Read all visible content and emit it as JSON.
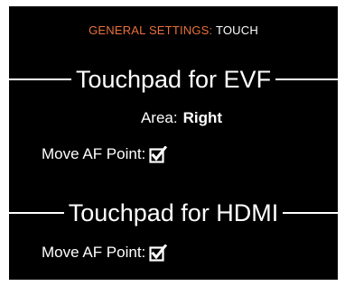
{
  "theme": {
    "background": "#000000",
    "text": "#ffffff",
    "accent": "#e8703a"
  },
  "header": {
    "crumb": "GENERAL SETTINGS:",
    "current": "TOUCH"
  },
  "sections": {
    "evf": {
      "title": "Touchpad for EVF",
      "area_label": "Area:",
      "area_value": "Right",
      "move_af_label": "Move AF Point:",
      "move_af_checked": true,
      "move_af_icon": "checkbox-checked-icon"
    },
    "hdmi": {
      "title": "Touchpad for HDMI",
      "move_af_label": "Move AF Point:",
      "move_af_checked": true,
      "move_af_icon": "checkbox-checked-icon"
    }
  }
}
